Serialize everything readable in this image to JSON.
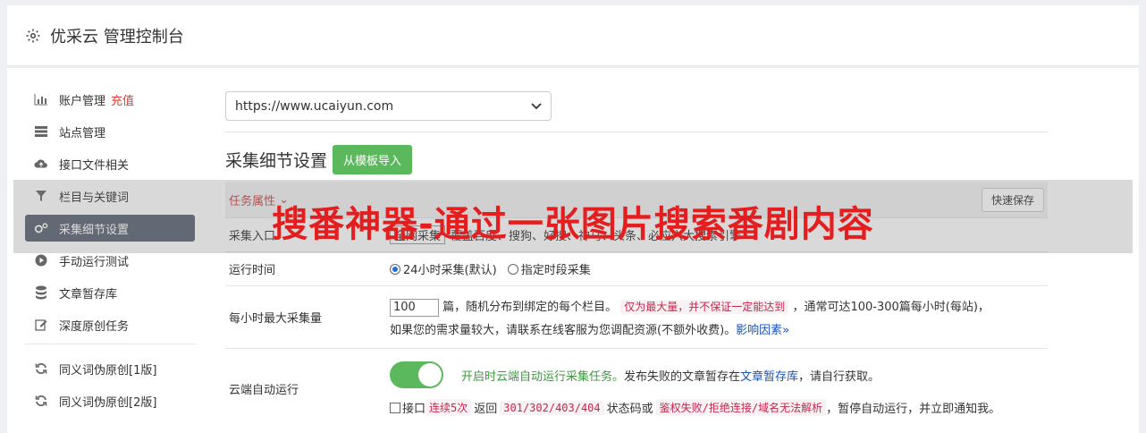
{
  "header": {
    "title": "优采云 管理控制台"
  },
  "sidebar": {
    "items": [
      {
        "label": "账户管理",
        "extra": "充值",
        "icon": "bar-chart-icon"
      },
      {
        "label": "站点管理",
        "icon": "server-icon"
      },
      {
        "label": "接口文件相关",
        "icon": "cloud-upload-icon"
      },
      {
        "label": "栏目与关键词",
        "icon": "filter-icon"
      },
      {
        "label": "采集细节设置",
        "icon": "gears-icon",
        "active": true
      },
      {
        "label": "手动运行测试",
        "icon": "play-circle-icon"
      },
      {
        "label": "文章暂存库",
        "icon": "database-icon"
      },
      {
        "label": "深度原创任务",
        "icon": "edit-icon"
      }
    ],
    "items2": [
      {
        "label": "同义词伪原创[1版]",
        "icon": "refresh-icon"
      },
      {
        "label": "同义词伪原创[2版]",
        "icon": "refresh-icon"
      }
    ]
  },
  "main": {
    "site_select": "https://www.ucaiyun.com",
    "section_title": "采集细节设置",
    "import_button": "从模板导入",
    "task_attr": "任务属性",
    "save_button": "快速保存",
    "rows": {
      "scope_label": "采集入口",
      "scope_value": "全网采集",
      "scope_desc": "覆盖百度、搜狗、好搜、神马、头条、必应六大搜索引擎",
      "runtime_label": "运行时间",
      "runtime_opt1": "24小时采集(默认)",
      "runtime_opt2": "指定时段采集",
      "max_label": "每小时最大采集量",
      "max_value": "100",
      "max_text1": "篇，随机分布到绑定的每个栏目。",
      "max_code": "仅为最大量，并不保证一定能达到",
      "max_text2": "，通常可达100-300篇每小时(每站)，",
      "max_text3": "如果您的需求量较大，请联系在线客服为您调配资源(不额外收费)。",
      "max_link": "影响因素",
      "cloud_label": "云端自动运行",
      "cloud_green": "开启时云端自动运行采集任务。",
      "cloud_text1": "发布失败的文章暂存在",
      "cloud_link": "文章暂存库",
      "cloud_text2": "，请自行获取。",
      "cloud_cb_label": "接口",
      "cloud_code1": "连续5次",
      "cloud_text3": "返回",
      "cloud_code2": "301/302/403/404",
      "cloud_text4": "状态码或",
      "cloud_code3": "鉴权失败/拒绝连接/域名无法解析",
      "cloud_text5": "，暂停自动运行，并立即通知我。"
    }
  },
  "overlay": {
    "text": "搜番神器-通过一张图片搜索番剧内容"
  }
}
